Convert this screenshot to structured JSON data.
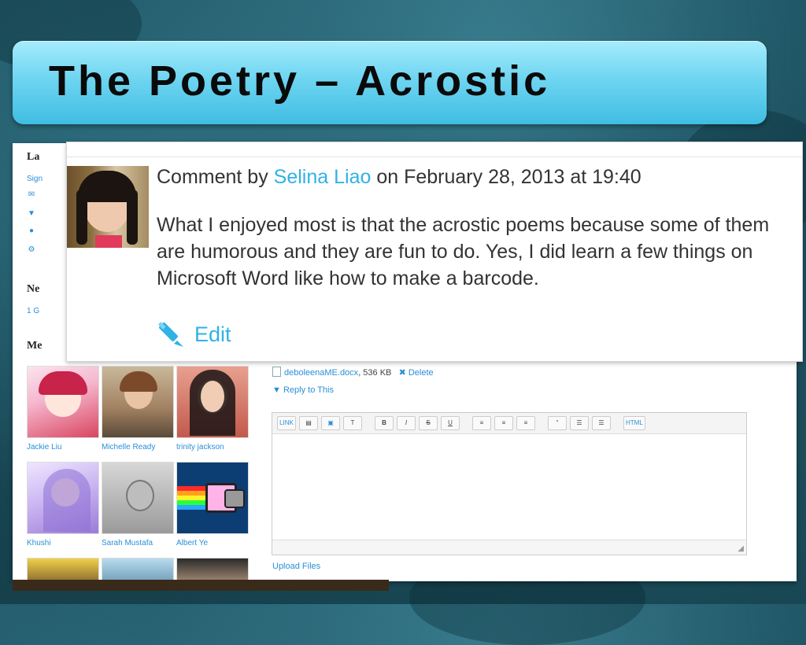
{
  "slide": {
    "title": "The Poetry – Acrostic"
  },
  "sidebar": {
    "heading_1": "La",
    "sign_link": "Sign",
    "icons": [
      "envelope-icon",
      "filter-icon",
      "person-icon",
      "gear-icon"
    ],
    "heading_2": "Ne",
    "group_link": "1 G",
    "heading_3": "Me"
  },
  "members": [
    {
      "name": "Jackie Liu",
      "icon": "anime-avatar"
    },
    {
      "name": "Michelle Ready",
      "icon": "photo-avatar"
    },
    {
      "name": "trinity jackson",
      "icon": "photo-avatar"
    },
    {
      "name": "Khushi",
      "icon": "anime-avatar"
    },
    {
      "name": "Sarah Mustafa",
      "icon": "photo-avatar"
    },
    {
      "name": "Albert Ye",
      "icon": "nyan-cat-avatar"
    },
    {
      "name": "",
      "icon": "photo-avatar"
    },
    {
      "name": "",
      "icon": "photo-avatar"
    },
    {
      "name": "",
      "icon": "photo-avatar"
    }
  ],
  "attachment": {
    "filename": "deboleenaME.docx",
    "size": ", 536 KB",
    "delete_label": "Delete",
    "reply_label": "Reply to This"
  },
  "editor": {
    "toolbar": [
      "LINK",
      "▤",
      "▣",
      "T",
      "B",
      "I",
      "S",
      "U",
      "≡",
      "≡",
      "≡",
      "“",
      "☰",
      "☰",
      "HTML"
    ],
    "upload_label": "Upload Files"
  },
  "comment": {
    "prefix": "Comment by ",
    "author": "Selina Liao",
    "suffix": " on February 28, 2013 at 19:40",
    "body": "What I enjoyed most is that the acrostic poems because some of them are humorous and they are fun to do. Yes, I did learn a few things on Microsoft Word like how to make a barcode.",
    "edit_label": "Edit"
  },
  "colors": {
    "link": "#2fb2e6",
    "banner": "#6fd5f1",
    "text": "#333333"
  }
}
